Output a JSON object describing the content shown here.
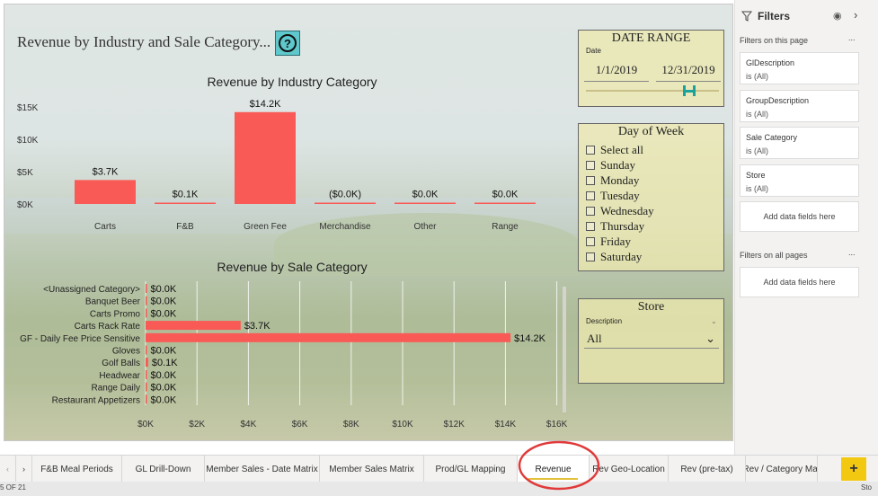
{
  "report": {
    "title": "Revenue by Industry and Sale Category...",
    "help_icon": "question-circle-icon"
  },
  "date_range": {
    "title": "DATE RANGE",
    "label": "Date",
    "start": "1/1/2019",
    "end": "12/31/2019"
  },
  "day_of_week": {
    "title": "Day of Week",
    "items": [
      "Select all",
      "Sunday",
      "Monday",
      "Tuesday",
      "Wednesday",
      "Thursday",
      "Friday",
      "Saturday"
    ]
  },
  "store": {
    "title": "Store",
    "label": "Description",
    "value": "All"
  },
  "filters": {
    "title": "Filters",
    "on_this_page": "Filters on this page",
    "cards": [
      {
        "name": "GlDescription",
        "value": "is (All)"
      },
      {
        "name": "GroupDescription",
        "value": "is (All)"
      },
      {
        "name": "Sale Category",
        "value": "is (All)"
      },
      {
        "name": "Store",
        "value": "is (All)"
      }
    ],
    "add_fields": "Add data fields here",
    "on_all_pages": "Filters on all pages",
    "ellipsis": "..."
  },
  "tabs": [
    "F&B Meal Periods",
    "GL Drill-Down",
    "Member Sales - Date Matrix",
    "Member Sales Matrix",
    "Prod/GL Mapping",
    "Revenue",
    "Rev Geo-Location",
    "Rev (pre-tax)",
    "Rev / Category Mat"
  ],
  "active_tab": "Revenue",
  "status": {
    "page": "5 OF 21",
    "right": "Sto"
  },
  "colors": {
    "bar": "#fa5a55",
    "accent": "#e2c13b",
    "highlight": "#e03a3a"
  },
  "chart_data": [
    {
      "type": "bar",
      "title": "Revenue by Industry Category",
      "categories": [
        "Carts",
        "F&B",
        "Green Fee",
        "Merchandise",
        "Other",
        "Range"
      ],
      "values": [
        3.7,
        0.1,
        14.2,
        -0.0,
        0.0,
        0.0
      ],
      "data_labels": [
        "$3.7K",
        "$0.1K",
        "$14.2K",
        "($0.0K)",
        "$0.0K",
        "$0.0K"
      ],
      "yticks": [
        "$0K",
        "$5K",
        "$10K",
        "$15K"
      ],
      "ylim": [
        0,
        15
      ]
    },
    {
      "type": "bar",
      "orientation": "horizontal",
      "title": "Revenue by Sale Category",
      "categories": [
        "<Unassigned Category>",
        "Banquet Beer",
        "Carts Promo",
        "Carts Rack Rate",
        "GF - Daily Fee Price Sensitive",
        "Gloves",
        "Golf Balls",
        "Headwear",
        "Range Daily",
        "Restaurant Appetizers"
      ],
      "values": [
        0.0,
        0.0,
        0.0,
        3.7,
        14.2,
        0.0,
        0.1,
        0.0,
        0.0,
        0.0
      ],
      "data_labels": [
        "$0.0K",
        "$0.0K",
        "$0.0K",
        "$3.7K",
        "$14.2K",
        "$0.0K",
        "$0.1K",
        "$0.0K",
        "$0.0K",
        "$0.0K"
      ],
      "xticks": [
        "$0K",
        "$2K",
        "$4K",
        "$6K",
        "$8K",
        "$10K",
        "$12K",
        "$14K",
        "$16K"
      ],
      "xlim": [
        0,
        16
      ]
    }
  ]
}
